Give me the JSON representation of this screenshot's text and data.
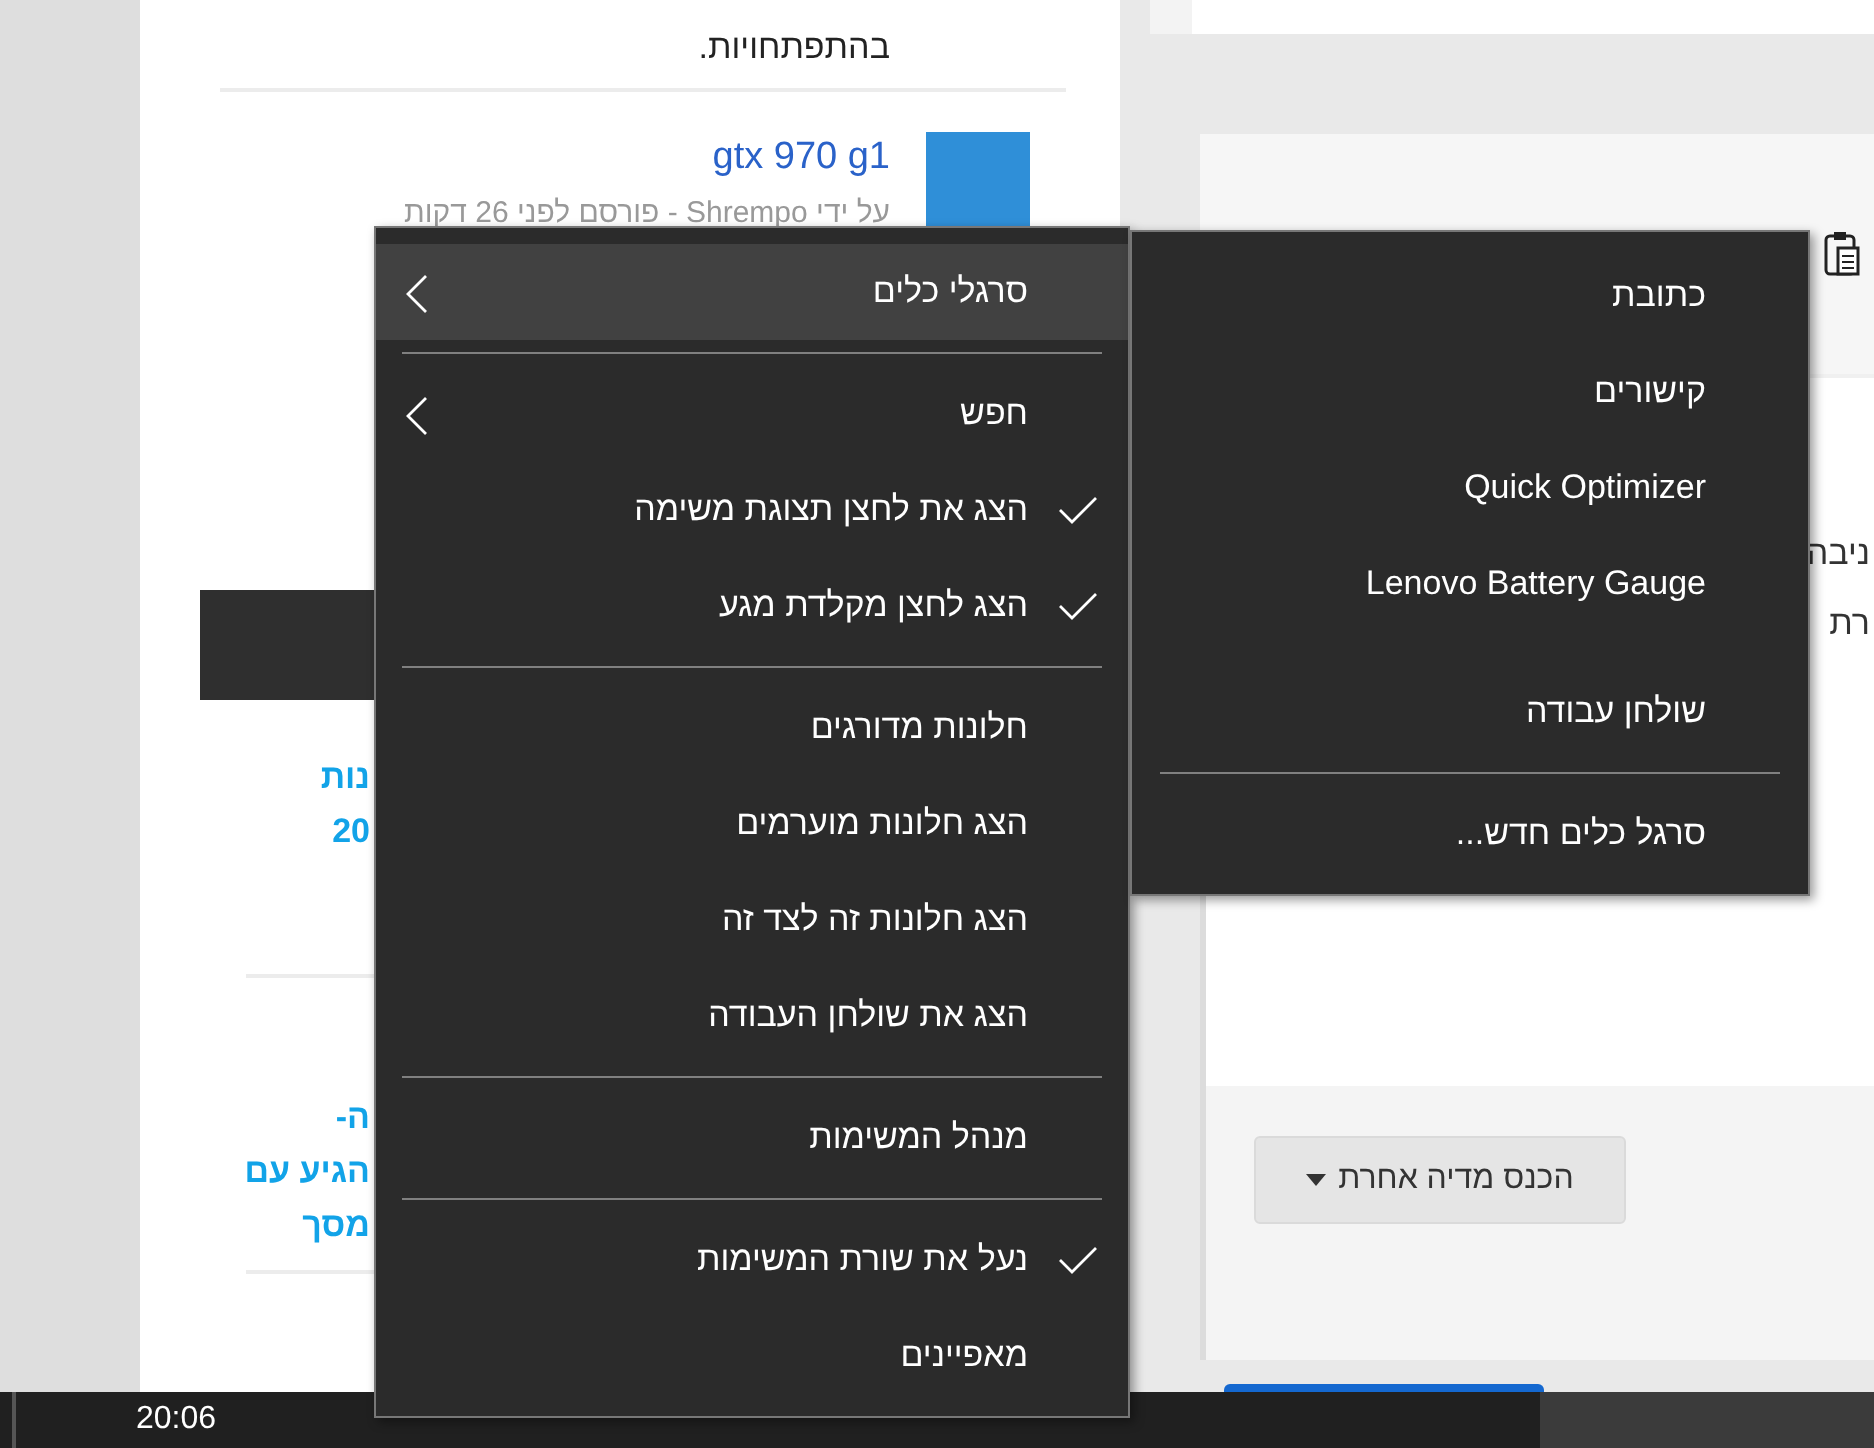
{
  "post": {
    "text": "בהתפתחויות."
  },
  "topic": {
    "title": "gtx 970 g1",
    "meta": "על ידי Shrempo - פורסם לפני 26 דקות"
  },
  "snippets": [
    {
      "lines": [
        "נות",
        "20"
      ]
    },
    {
      "lines": [
        "ה-",
        "הגיע עם",
        "מסך"
      ]
    }
  ],
  "side_panel": {
    "lines": [
      "ניבה",
      "רת"
    ],
    "media_button": {
      "label": "הכנס מדיה אחרת"
    }
  },
  "taskbar": {
    "clock": "20:06"
  },
  "context_menu": {
    "items": [
      {
        "kind": "item",
        "label": "סרגלי כלים",
        "checked": false,
        "submenu": true,
        "highlighted": true
      },
      {
        "kind": "separator"
      },
      {
        "kind": "item",
        "label": "חפש",
        "checked": false,
        "submenu": true,
        "highlighted": false
      },
      {
        "kind": "item",
        "label": "הצג את לחצן תצוגת משימה",
        "checked": true,
        "submenu": false,
        "highlighted": false
      },
      {
        "kind": "item",
        "label": "הצג לחצן מקלדת מגע",
        "checked": true,
        "submenu": false,
        "highlighted": false
      },
      {
        "kind": "separator"
      },
      {
        "kind": "item",
        "label": "חלונות מדורגים",
        "checked": false,
        "submenu": false,
        "highlighted": false
      },
      {
        "kind": "item",
        "label": "הצג חלונות מוערמים",
        "checked": false,
        "submenu": false,
        "highlighted": false
      },
      {
        "kind": "item",
        "label": "הצג חלונות זה לצד זה",
        "checked": false,
        "submenu": false,
        "highlighted": false
      },
      {
        "kind": "item",
        "label": "הצג את שולחן העבודה",
        "checked": false,
        "submenu": false,
        "highlighted": false
      },
      {
        "kind": "separator"
      },
      {
        "kind": "item",
        "label": "מנהל המשימות",
        "checked": false,
        "submenu": false,
        "highlighted": false
      },
      {
        "kind": "separator"
      },
      {
        "kind": "item",
        "label": "נעל את שורת המשימות",
        "checked": true,
        "submenu": false,
        "highlighted": false
      },
      {
        "kind": "item",
        "label": "מאפיינים",
        "checked": false,
        "submenu": false,
        "highlighted": false
      }
    ]
  },
  "submenu": {
    "items": [
      {
        "kind": "item",
        "label": "כתובת"
      },
      {
        "kind": "item",
        "label": "קישורים"
      },
      {
        "kind": "item",
        "label": "Quick Optimizer"
      },
      {
        "kind": "item",
        "label": "Lenovo Battery Gauge"
      },
      {
        "kind": "item",
        "label": "שולחן עבודה"
      },
      {
        "kind": "separator"
      },
      {
        "kind": "item",
        "label": "סרגל כלים חדש..."
      }
    ]
  }
}
